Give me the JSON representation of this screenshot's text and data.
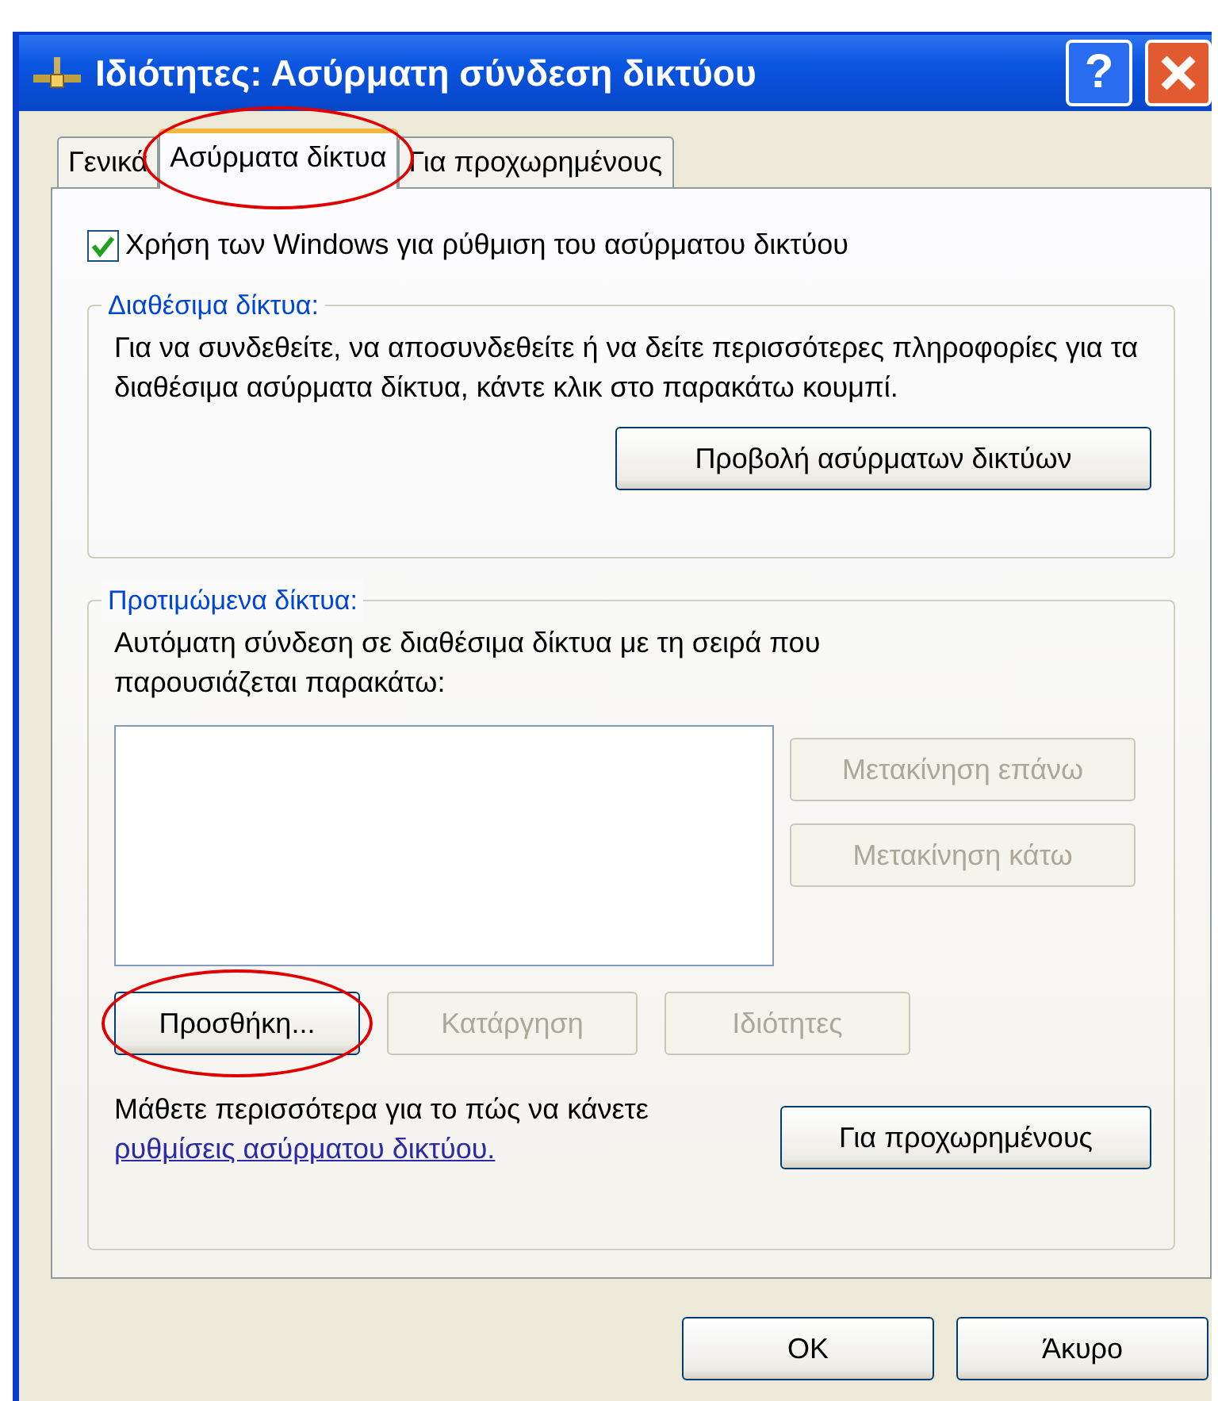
{
  "window": {
    "title": "Ιδιότητες: Ασύρματη σύνδεση δικτύου"
  },
  "help_button": {
    "label": "?"
  },
  "tabs": [
    {
      "label": "Γενικά",
      "selected": false,
      "highlighted": false
    },
    {
      "label": "Ασύρματα δίκτυα",
      "selected": true,
      "highlighted": true
    },
    {
      "label": "Για προχωρημένους",
      "selected": false,
      "highlighted": false
    }
  ],
  "use_windows_checkbox": {
    "label": "Χρήση των Windows για ρύθμιση του ασύρματου δικτύου",
    "checked": true
  },
  "available_networks": {
    "legend": "Διαθέσιμα δίκτυα:",
    "description": "Για να συνδεθείτε, να αποσυνδεθείτε ή να δείτε περισσότερες πληροφορίες για τα διαθέσιμα ασύρματα δίκτυα, κάντε κλικ στο παρακάτω κουμπί.",
    "button": {
      "label": "Προβολή ασύρματων δικτύων",
      "disabled": false
    }
  },
  "preferred_networks": {
    "legend": "Προτιμώμενα δίκτυα:",
    "description": "Αυτόματη σύνδεση σε διαθέσιμα δίκτυα με τη σειρά που παρουσιάζεται παρακάτω:",
    "side_buttons": [
      {
        "label": "Μετακίνηση επάνω",
        "disabled": true
      },
      {
        "label": "Μετακίνηση κάτω",
        "disabled": true
      }
    ],
    "buttons": [
      {
        "label": "Προσθήκη...",
        "disabled": false,
        "highlighted": true
      },
      {
        "label": "Κατάργηση",
        "disabled": true,
        "highlighted": false
      },
      {
        "label": "Ιδιότητες",
        "disabled": true,
        "highlighted": false
      }
    ],
    "learn_more": {
      "text": "Μάθετε περισσότερα για το πώς να κάνετε ",
      "link": "ρυθμίσεις ασύρματου δικτύου."
    },
    "advanced_button": {
      "label": "Για προχωρημένους",
      "disabled": false
    }
  },
  "dialog_buttons": [
    {
      "label": "OK",
      "disabled": false
    },
    {
      "label": "Άκυρο",
      "disabled": false
    }
  ]
}
